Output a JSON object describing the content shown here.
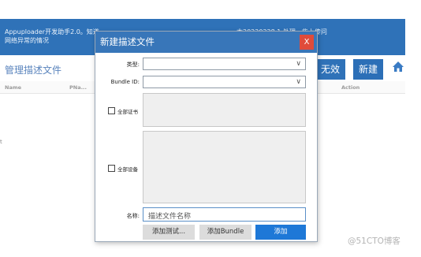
{
  "app": {
    "banner_line1": "Appuploader开发助手2.0。知道",
    "banner_line2": "网络异常的情况",
    "banner_right": "本20220228.1,处理一些上传问",
    "page_title": "管理描述文件",
    "invalid_button": "无效",
    "create_button": "新建",
    "home_icon": "home-icon",
    "table_headers": [
      "Name",
      "PNa...",
      "Action"
    ],
    "side_mark": "t"
  },
  "dialog": {
    "title": "新建描述文件",
    "close_label": "X",
    "type_label": "类型:",
    "bundle_label": "Bundle ID:",
    "all_certs_label": "全部证书",
    "all_devices_label": "全部设备",
    "name_label": "名称:",
    "name_placeholder": "描述文件名称",
    "add_test_button": "添加测试...",
    "add_bundle_button": "添加Bundle",
    "add_button": "添加"
  },
  "colors": {
    "header_blue": "#2f72b8",
    "dialog_titlebar": "#3876b9",
    "close_red": "#e04b3a",
    "primary_button": "#1e78d7"
  },
  "watermark": "@51CTO博客"
}
